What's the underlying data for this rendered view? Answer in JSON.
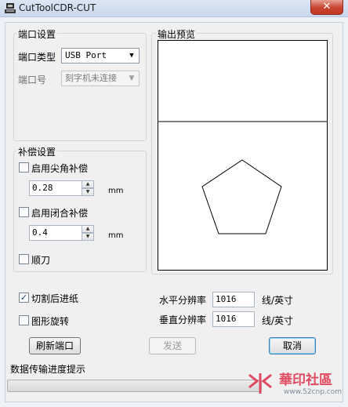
{
  "window": {
    "title": "CutToolCDR-CUT",
    "close_glyph": "✕"
  },
  "port_settings": {
    "group_title": "端口设置",
    "port_type_label": "端口类型",
    "port_type_value": "USB Port",
    "port_no_label": "端口号",
    "port_no_value": "刻字机未连接"
  },
  "compensation": {
    "group_title": "补偿设置",
    "sharp_corner_label": "启用尖角补偿",
    "sharp_corner_checked": false,
    "sharp_corner_value": "0.28",
    "sharp_corner_unit": "mm",
    "closed_label": "启用闭合补偿",
    "closed_checked": false,
    "closed_value": "0.4",
    "closed_unit": "mm",
    "knife_label": "顺刀",
    "knife_checked": false
  },
  "preview": {
    "group_title": "输出预览"
  },
  "options": {
    "feed_after_cut_label": "切割后进纸",
    "feed_after_cut_checked": true,
    "rotate_label": "图形旋转",
    "rotate_checked": false
  },
  "resolution": {
    "horizontal_label": "水平分辨率",
    "horizontal_value": "1016",
    "horizontal_unit": "线/英寸",
    "vertical_label": "垂直分辨率",
    "vertical_value": "1016",
    "vertical_unit": "线/英寸"
  },
  "buttons": {
    "refresh_label": "刷新端口",
    "send_label": "发送",
    "cancel_label": "取消"
  },
  "progress": {
    "label": "数据传输进度提示",
    "value": 0
  },
  "watermark": {
    "text": "華印社區",
    "url": "www.52cnp.com"
  },
  "colors": {
    "accent": "#3c7fb1",
    "close_button": "#c8442f",
    "watermark": "#e04a60"
  }
}
